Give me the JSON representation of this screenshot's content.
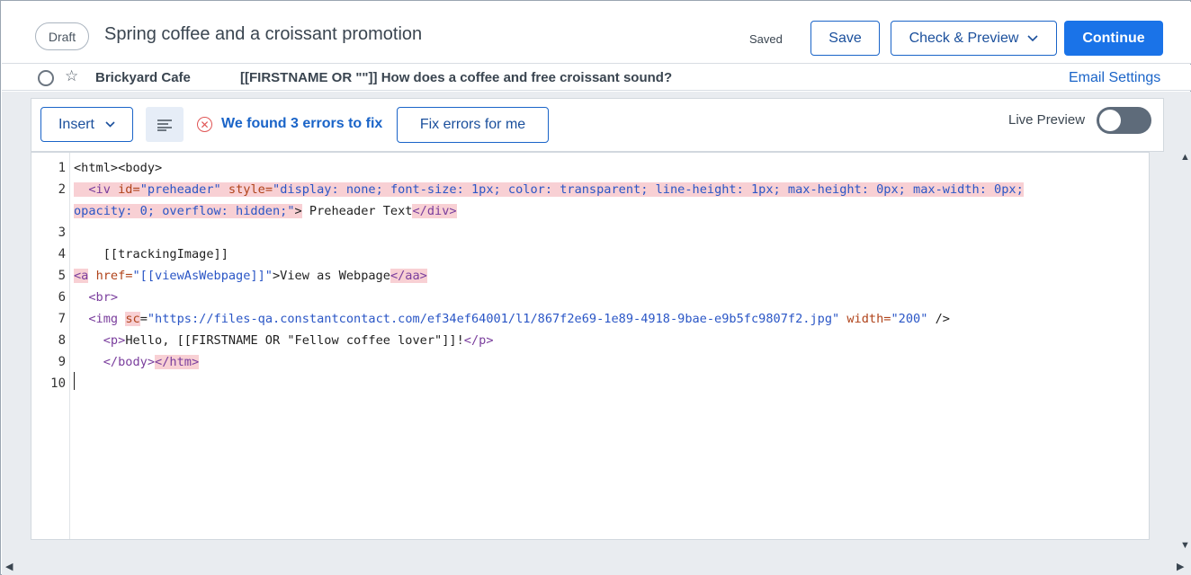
{
  "header": {
    "status_badge": "Draft",
    "title": "Spring coffee and a croissant promotion",
    "saved_status": "Saved",
    "save_label": "Save",
    "check_preview_label": "Check & Preview",
    "continue_label": "Continue"
  },
  "subject_row": {
    "from_name": "Brickyard Cafe",
    "subject": "[[FIRSTNAME OR \"\"]] How does a coffee and free croissant sound?",
    "email_settings_label": "Email Settings"
  },
  "toolbar": {
    "insert_label": "Insert",
    "error_message": "We found 3 errors to fix",
    "fix_errors_label": "Fix errors for me",
    "live_preview_label": "Live Preview",
    "live_preview_on": false
  },
  "editor": {
    "line_numbers": [
      "1",
      "2",
      "3",
      "4",
      "5",
      "6",
      "7",
      "8",
      "9",
      "10"
    ],
    "lines": {
      "l1": {
        "a": "<html>",
        "b": "<body>"
      },
      "l2": {
        "a": "<iv",
        "b": "id=",
        "c": "\"preheader\"",
        "d": "style=",
        "e": "\"display: none; font-size: 1px; color: transparent; line-height: 1px; max-height: 0px; max-width: 0px;",
        "f": "opacity: 0; overflow: hidden;\"",
        "g": ">",
        "h": " Preheader Text",
        "i": "</div>"
      },
      "l4": {
        "a": "[[trackingImage]]"
      },
      "l5": {
        "a": "<a",
        "b": "href=",
        "c": "\"[[viewAsWebpage]]\"",
        "d": ">View as Webpage",
        "e": "</aa>"
      },
      "l6": {
        "a": "<br>"
      },
      "l7": {
        "a": "<img",
        "b": "sc",
        "c": "=",
        "d": "\"https://files-qa.constantcontact.com/ef34ef64001/l1/867f2e69-1e89-4918-9bae-e9b5fc9807f2.jpg\"",
        "e": "width=",
        "f": "\"200\"",
        "g": " />"
      },
      "l8": {
        "a": "<p>",
        "b": "Hello, [[FIRSTNAME OR \"Fellow coffee lover\"]]!",
        "c": "</p>"
      },
      "l9": {
        "a": "</body>",
        "b": "</htm>"
      }
    }
  },
  "icons": {
    "check_preview_chevron": "chevron-down-icon",
    "insert_chevron": "chevron-down-icon",
    "align": "align-left-icon",
    "error": "error-circle-icon",
    "select": "radio-circle-icon",
    "favorite": "star-icon"
  },
  "colors": {
    "primary": "#1a73e8",
    "link": "#1a64c8",
    "error": "#e05555",
    "error_highlight": "#f8d0d4",
    "toggle_off": "#5e6b7a"
  }
}
